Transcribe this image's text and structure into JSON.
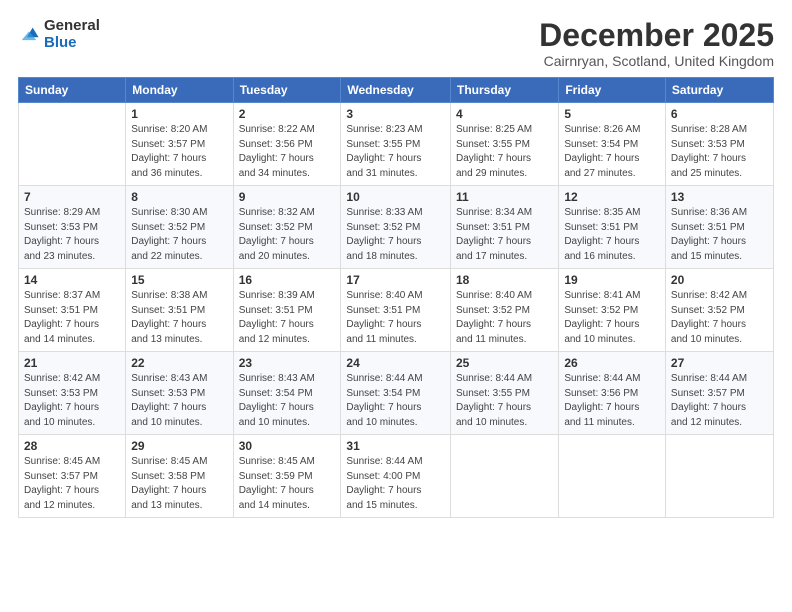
{
  "logo": {
    "general": "General",
    "blue": "Blue"
  },
  "header": {
    "title": "December 2025",
    "location": "Cairnryan, Scotland, United Kingdom"
  },
  "days_of_week": [
    "Sunday",
    "Monday",
    "Tuesday",
    "Wednesday",
    "Thursday",
    "Friday",
    "Saturday"
  ],
  "weeks": [
    [
      {
        "day": "",
        "info": ""
      },
      {
        "day": "1",
        "info": "Sunrise: 8:20 AM\nSunset: 3:57 PM\nDaylight: 7 hours\nand 36 minutes."
      },
      {
        "day": "2",
        "info": "Sunrise: 8:22 AM\nSunset: 3:56 PM\nDaylight: 7 hours\nand 34 minutes."
      },
      {
        "day": "3",
        "info": "Sunrise: 8:23 AM\nSunset: 3:55 PM\nDaylight: 7 hours\nand 31 minutes."
      },
      {
        "day": "4",
        "info": "Sunrise: 8:25 AM\nSunset: 3:55 PM\nDaylight: 7 hours\nand 29 minutes."
      },
      {
        "day": "5",
        "info": "Sunrise: 8:26 AM\nSunset: 3:54 PM\nDaylight: 7 hours\nand 27 minutes."
      },
      {
        "day": "6",
        "info": "Sunrise: 8:28 AM\nSunset: 3:53 PM\nDaylight: 7 hours\nand 25 minutes."
      }
    ],
    [
      {
        "day": "7",
        "info": "Sunrise: 8:29 AM\nSunset: 3:53 PM\nDaylight: 7 hours\nand 23 minutes."
      },
      {
        "day": "8",
        "info": "Sunrise: 8:30 AM\nSunset: 3:52 PM\nDaylight: 7 hours\nand 22 minutes."
      },
      {
        "day": "9",
        "info": "Sunrise: 8:32 AM\nSunset: 3:52 PM\nDaylight: 7 hours\nand 20 minutes."
      },
      {
        "day": "10",
        "info": "Sunrise: 8:33 AM\nSunset: 3:52 PM\nDaylight: 7 hours\nand 18 minutes."
      },
      {
        "day": "11",
        "info": "Sunrise: 8:34 AM\nSunset: 3:51 PM\nDaylight: 7 hours\nand 17 minutes."
      },
      {
        "day": "12",
        "info": "Sunrise: 8:35 AM\nSunset: 3:51 PM\nDaylight: 7 hours\nand 16 minutes."
      },
      {
        "day": "13",
        "info": "Sunrise: 8:36 AM\nSunset: 3:51 PM\nDaylight: 7 hours\nand 15 minutes."
      }
    ],
    [
      {
        "day": "14",
        "info": "Sunrise: 8:37 AM\nSunset: 3:51 PM\nDaylight: 7 hours\nand 14 minutes."
      },
      {
        "day": "15",
        "info": "Sunrise: 8:38 AM\nSunset: 3:51 PM\nDaylight: 7 hours\nand 13 minutes."
      },
      {
        "day": "16",
        "info": "Sunrise: 8:39 AM\nSunset: 3:51 PM\nDaylight: 7 hours\nand 12 minutes."
      },
      {
        "day": "17",
        "info": "Sunrise: 8:40 AM\nSunset: 3:51 PM\nDaylight: 7 hours\nand 11 minutes."
      },
      {
        "day": "18",
        "info": "Sunrise: 8:40 AM\nSunset: 3:52 PM\nDaylight: 7 hours\nand 11 minutes."
      },
      {
        "day": "19",
        "info": "Sunrise: 8:41 AM\nSunset: 3:52 PM\nDaylight: 7 hours\nand 10 minutes."
      },
      {
        "day": "20",
        "info": "Sunrise: 8:42 AM\nSunset: 3:52 PM\nDaylight: 7 hours\nand 10 minutes."
      }
    ],
    [
      {
        "day": "21",
        "info": "Sunrise: 8:42 AM\nSunset: 3:53 PM\nDaylight: 7 hours\nand 10 minutes."
      },
      {
        "day": "22",
        "info": "Sunrise: 8:43 AM\nSunset: 3:53 PM\nDaylight: 7 hours\nand 10 minutes."
      },
      {
        "day": "23",
        "info": "Sunrise: 8:43 AM\nSunset: 3:54 PM\nDaylight: 7 hours\nand 10 minutes."
      },
      {
        "day": "24",
        "info": "Sunrise: 8:44 AM\nSunset: 3:54 PM\nDaylight: 7 hours\nand 10 minutes."
      },
      {
        "day": "25",
        "info": "Sunrise: 8:44 AM\nSunset: 3:55 PM\nDaylight: 7 hours\nand 10 minutes."
      },
      {
        "day": "26",
        "info": "Sunrise: 8:44 AM\nSunset: 3:56 PM\nDaylight: 7 hours\nand 11 minutes."
      },
      {
        "day": "27",
        "info": "Sunrise: 8:44 AM\nSunset: 3:57 PM\nDaylight: 7 hours\nand 12 minutes."
      }
    ],
    [
      {
        "day": "28",
        "info": "Sunrise: 8:45 AM\nSunset: 3:57 PM\nDaylight: 7 hours\nand 12 minutes."
      },
      {
        "day": "29",
        "info": "Sunrise: 8:45 AM\nSunset: 3:58 PM\nDaylight: 7 hours\nand 13 minutes."
      },
      {
        "day": "30",
        "info": "Sunrise: 8:45 AM\nSunset: 3:59 PM\nDaylight: 7 hours\nand 14 minutes."
      },
      {
        "day": "31",
        "info": "Sunrise: 8:44 AM\nSunset: 4:00 PM\nDaylight: 7 hours\nand 15 minutes."
      },
      {
        "day": "",
        "info": ""
      },
      {
        "day": "",
        "info": ""
      },
      {
        "day": "",
        "info": ""
      }
    ]
  ]
}
